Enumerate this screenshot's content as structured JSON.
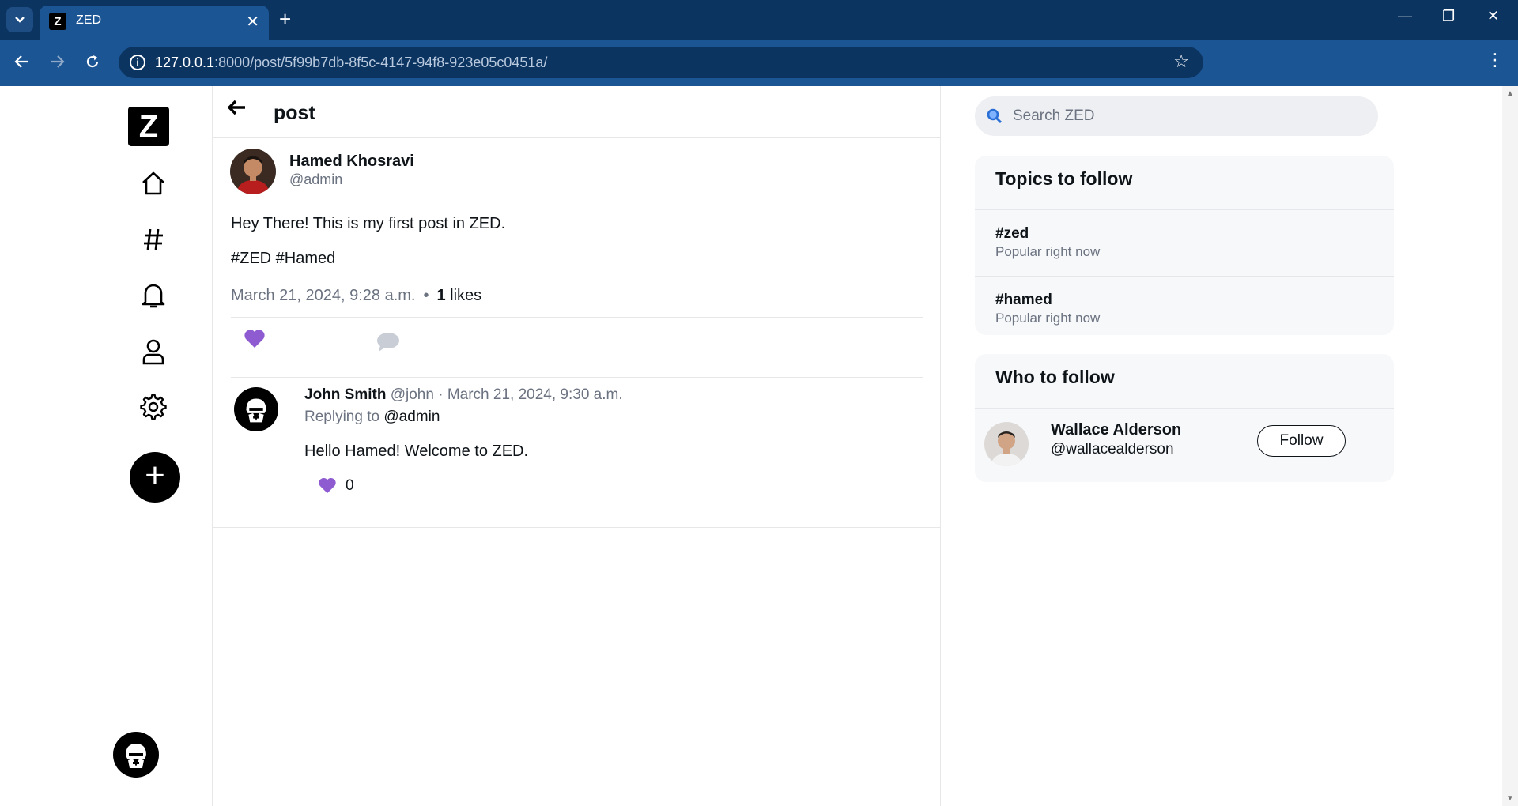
{
  "browser": {
    "tab_title": "ZED",
    "tab_favicon_letter": "Z",
    "url_host": "127.0.0.1",
    "url_rest": ":8000/post/5f99b7db-8f5c-4147-94f8-923e05c0451a/"
  },
  "sidebar": {
    "logo_letter": "Z",
    "items": [
      {
        "icon": "home-icon"
      },
      {
        "icon": "hashtag-icon"
      },
      {
        "icon": "bell-icon"
      },
      {
        "icon": "profile-icon"
      },
      {
        "icon": "gear-icon"
      }
    ],
    "compose_icon": "plus-icon"
  },
  "header": {
    "title": "post"
  },
  "post": {
    "author_name": "Hamed Khosravi",
    "author_handle": "@admin",
    "text": "Hey There! This is my first post in ZED.",
    "tags": "#ZED #Hamed",
    "timestamp": "March 21, 2024, 9:28 a.m.",
    "separator": "•",
    "likes_count": "1",
    "likes_label": "likes"
  },
  "reply": {
    "name": "John Smith",
    "meta": "@john · March 21, 2024, 9:30 a.m.",
    "replying_prefix": "Replying to",
    "replying_to": "@admin",
    "text": "Hello Hamed! Welcome to ZED.",
    "likes": "0"
  },
  "right": {
    "search_placeholder": "Search ZED",
    "topics_title": "Topics to follow",
    "topics": [
      {
        "tag": "#zed",
        "sub": "Popular right now"
      },
      {
        "tag": "#hamed",
        "sub": "Popular right now"
      }
    ],
    "who_title": "Who to follow",
    "suggestion": {
      "name": "Wallace Alderson",
      "handle": "@wallacealderson",
      "button": "Follow"
    }
  },
  "colors": {
    "like": "#8e5bd0",
    "chrome_dark": "#0c3461",
    "chrome": "#1c5594"
  }
}
